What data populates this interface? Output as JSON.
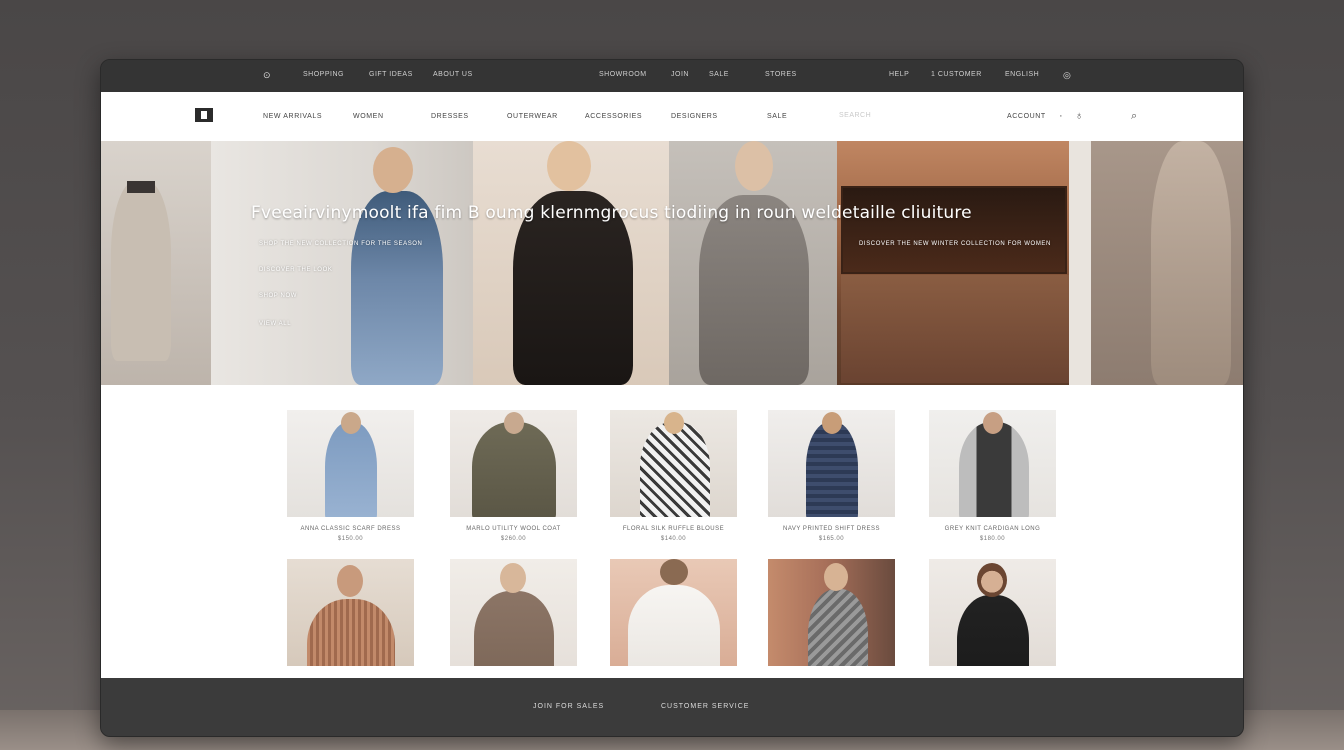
{
  "topbar": {
    "left_icon": "account-icon",
    "items": [
      "SHOPPING",
      "GIFT IDEAS",
      "ABOUT US"
    ],
    "center_items": [
      "SHOWROOM",
      "JOIN",
      "SALE",
      "STORES"
    ],
    "right_items": [
      "HELP",
      "1 CUSTOMER",
      "ENGLISH"
    ],
    "right_icon": "cart-icon"
  },
  "nav": {
    "items": [
      "NEW ARRIVALS",
      "WOMEN",
      "DRESSES",
      "OUTERWEAR",
      "ACCESSORIES",
      "DESIGNERS",
      "SALE"
    ],
    "search_placeholder": "SEARCH",
    "account_label": "ACCOUNT",
    "icons": [
      "user-icon",
      "bag-icon",
      "search-icon"
    ]
  },
  "hero": {
    "title": "Fveeairvinymoolt ifa fim B oumg klernmgrocus tiodiing in roun weldetaille cliuiture",
    "subtitle_lines": [
      "SHOP THE NEW COLLECTION FOR THE SEASON",
      "DISCOVER THE LOOK",
      "SHOP NOW",
      "VIEW ALL"
    ],
    "right_caption": "DISCOVER THE NEW WINTER COLLECTION FOR WOMEN"
  },
  "products": [
    {
      "name": "ANNA CLASSIC SCARF DRESS",
      "price": "$150.00"
    },
    {
      "name": "MARLO UTILITY WOOL COAT",
      "price": "$260.00"
    },
    {
      "name": "FLORAL SILK RUFFLE BLOUSE",
      "price": "$140.00"
    },
    {
      "name": "NAVY PRINTED SHIFT DRESS",
      "price": "$165.00"
    },
    {
      "name": "GREY KNIT CARDIGAN LONG",
      "price": "$180.00"
    },
    {
      "name": "",
      "price": ""
    },
    {
      "name": "",
      "price": ""
    },
    {
      "name": "",
      "price": ""
    },
    {
      "name": "",
      "price": ""
    },
    {
      "name": "",
      "price": ""
    }
  ],
  "footer": {
    "left": "JOIN FOR SALES",
    "right": "CUSTOMER SERVICE"
  },
  "colors": {
    "topbar": "#343434",
    "nav": "#ffffff",
    "footer": "#3b3b3b",
    "frame": "#3a3a3a"
  }
}
